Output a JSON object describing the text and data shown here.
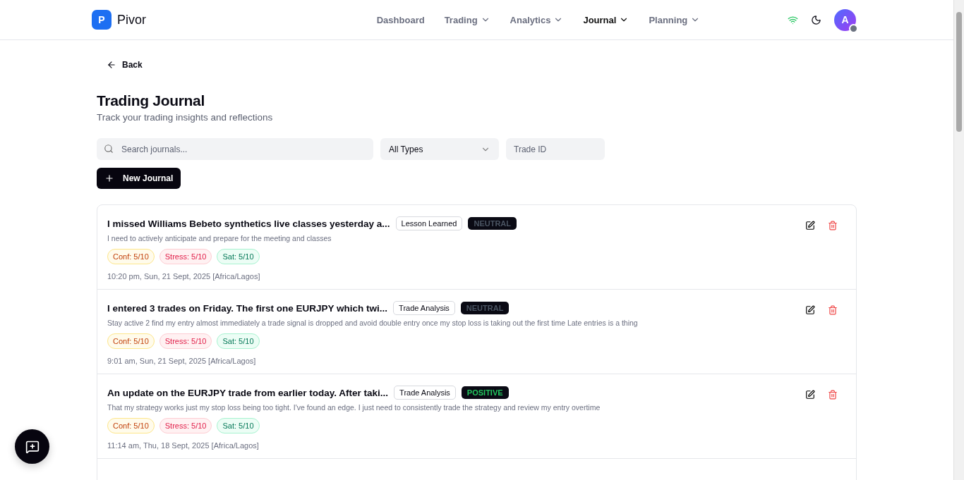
{
  "brand": {
    "logo_letter": "P",
    "name": "Pivor"
  },
  "nav": [
    {
      "label": "Dashboard",
      "selected": false,
      "has_menu": false
    },
    {
      "label": "Trading",
      "selected": false,
      "has_menu": true
    },
    {
      "label": "Analytics",
      "selected": false,
      "has_menu": true
    },
    {
      "label": "Journal",
      "selected": true,
      "has_menu": true
    },
    {
      "label": "Planning",
      "selected": false,
      "has_menu": true
    }
  ],
  "user": {
    "avatar_letter": "A"
  },
  "back": "Back",
  "page": {
    "title": "Trading Journal",
    "subtitle": "Track your trading insights and reflections"
  },
  "filters": {
    "search_placeholder": "Search journals...",
    "type_value": "All Types",
    "trade_id_placeholder": "Trade ID"
  },
  "new_button": "New Journal",
  "entries": [
    {
      "title": "I missed Williams Bebeto synthetics live classes yesterday a...",
      "category": "Lesson Learned",
      "sentiment": "NEUTRAL",
      "color": "#4b5563",
      "note": "I need to actively anticipate and prepare for the meeting and classes",
      "confidence": "Conf: 5/10",
      "stress": "Stress: 5/10",
      "satisfaction": "Sat: 5/10",
      "time": "10:20 pm, Sun, 21 Sept, 2025 [Africa/Lagos]"
    },
    {
      "title": "I entered 3 trades on Friday. The first one EURJPY which twi...",
      "category": "Trade Analysis",
      "sentiment": "NEUTRAL",
      "color": "#4b5563",
      "note": "Stay active 2 find my entry almost immediately a trade signal is dropped and avoid double entry once my stop loss is taking out the first time Late entries is a thing",
      "confidence": "Conf: 5/10",
      "stress": "Stress: 5/10",
      "satisfaction": "Sat: 5/10",
      "time": "9:01 am, Sun, 21 Sept, 2025 [Africa/Lagos]"
    },
    {
      "title": "An update on the EURJPY trade from earlier today. After taki...",
      "category": "Trade Analysis",
      "sentiment": "POSITIVE",
      "color": "#22c55e",
      "note": "That my strategy works just my stop loss being too tight. I've found an edge. I just need to consistently trade the strategy and review my entry overtime",
      "confidence": "Conf: 5/10",
      "stress": "Stress: 5/10",
      "satisfaction": "Sat: 5/10",
      "time": "11:14 am, Thu, 18 Sept, 2025 [Africa/Lagos]"
    }
  ]
}
